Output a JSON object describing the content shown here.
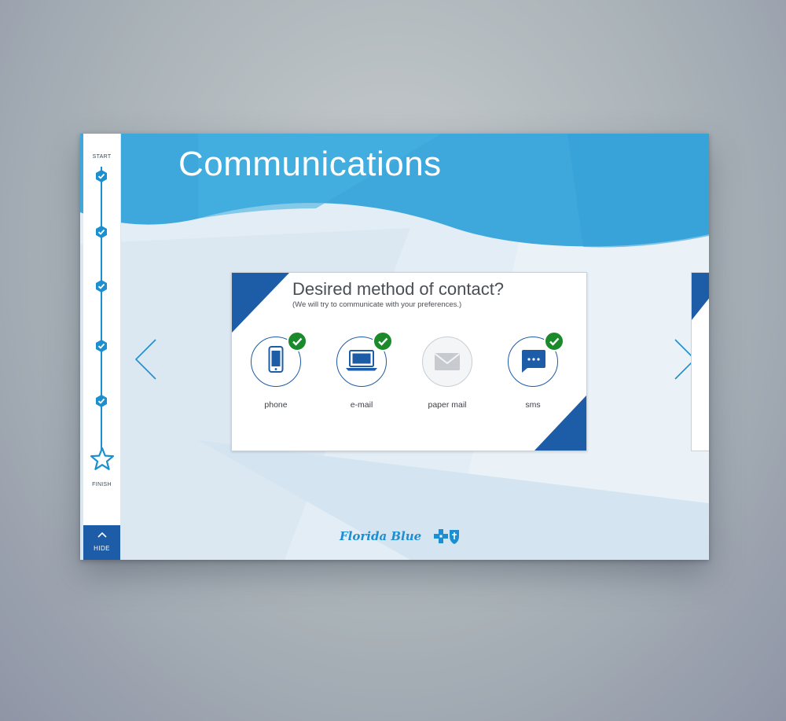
{
  "sidebar": {
    "start_label": "START",
    "finish_label": "FINISH",
    "steps_completed": 5,
    "hide_label": "HIDE"
  },
  "page": {
    "title": "Communications"
  },
  "card": {
    "question": "Desired method of contact?",
    "subtitle": "(We will try to communicate with your preferences.)",
    "options": [
      {
        "label": "phone",
        "icon": "phone-icon",
        "selected": true
      },
      {
        "label": "e-mail",
        "icon": "laptop-icon",
        "selected": true
      },
      {
        "label": "paper mail",
        "icon": "envelope-icon",
        "selected": false
      },
      {
        "label": "sms",
        "icon": "chat-bubble-icon",
        "selected": true
      }
    ]
  },
  "brand": {
    "name": "Florida Blue"
  },
  "colors": {
    "header_blue": "#3fa9dc",
    "navy": "#1d5ca6",
    "check_green": "#1a8a2a",
    "background": "#e4eef5"
  }
}
